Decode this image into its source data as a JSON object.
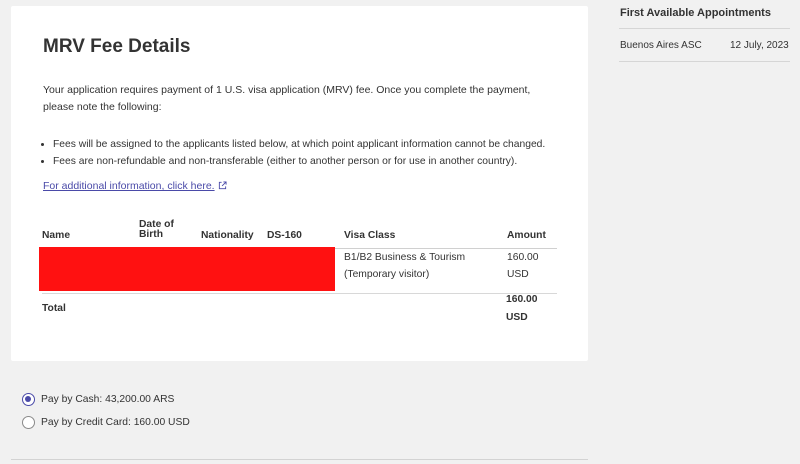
{
  "fee_card": {
    "title": "MRV Fee Details",
    "intro": "Your application requires payment of 1 U.S. visa application (MRV) fee. Once you complete the payment, please note the following:",
    "notes": [
      "Fees will be assigned to the applicants listed below, at which point applicant information cannot be changed.",
      "Fees are non-refundable and non-transferable (either to another person or for use in another country)."
    ],
    "info_link": "For additional information, click here.",
    "table": {
      "headers": {
        "name": "Name",
        "dob_line1": "Date of",
        "dob_line2": "Birth",
        "nationality": "Nationality",
        "ds160": "DS-160",
        "visa_class": "Visa Class",
        "amount": "Amount"
      },
      "rows": [
        {
          "visa_class_line1": "B1/B2 Business & Tourism",
          "visa_class_line2": "(Temporary visitor)",
          "amount_line1": "160.00",
          "amount_line2": "USD"
        }
      ],
      "total_label": "Total",
      "total_line1": "160.00",
      "total_line2": "USD"
    },
    "redaction_color": "#ff1111"
  },
  "sidebar": {
    "title": "First Available Appointments",
    "items": [
      {
        "location": "Buenos Aires ASC",
        "date": "12 July, 2023"
      }
    ]
  },
  "payment": {
    "options": [
      {
        "label": "Pay by Cash: 43,200.00 ARS",
        "selected": true
      },
      {
        "label": "Pay by Credit Card: 160.00 USD",
        "selected": false
      }
    ]
  },
  "colors": {
    "accent": "#4a4aa8",
    "background": "#f1f1f1",
    "card": "#ffffff"
  }
}
